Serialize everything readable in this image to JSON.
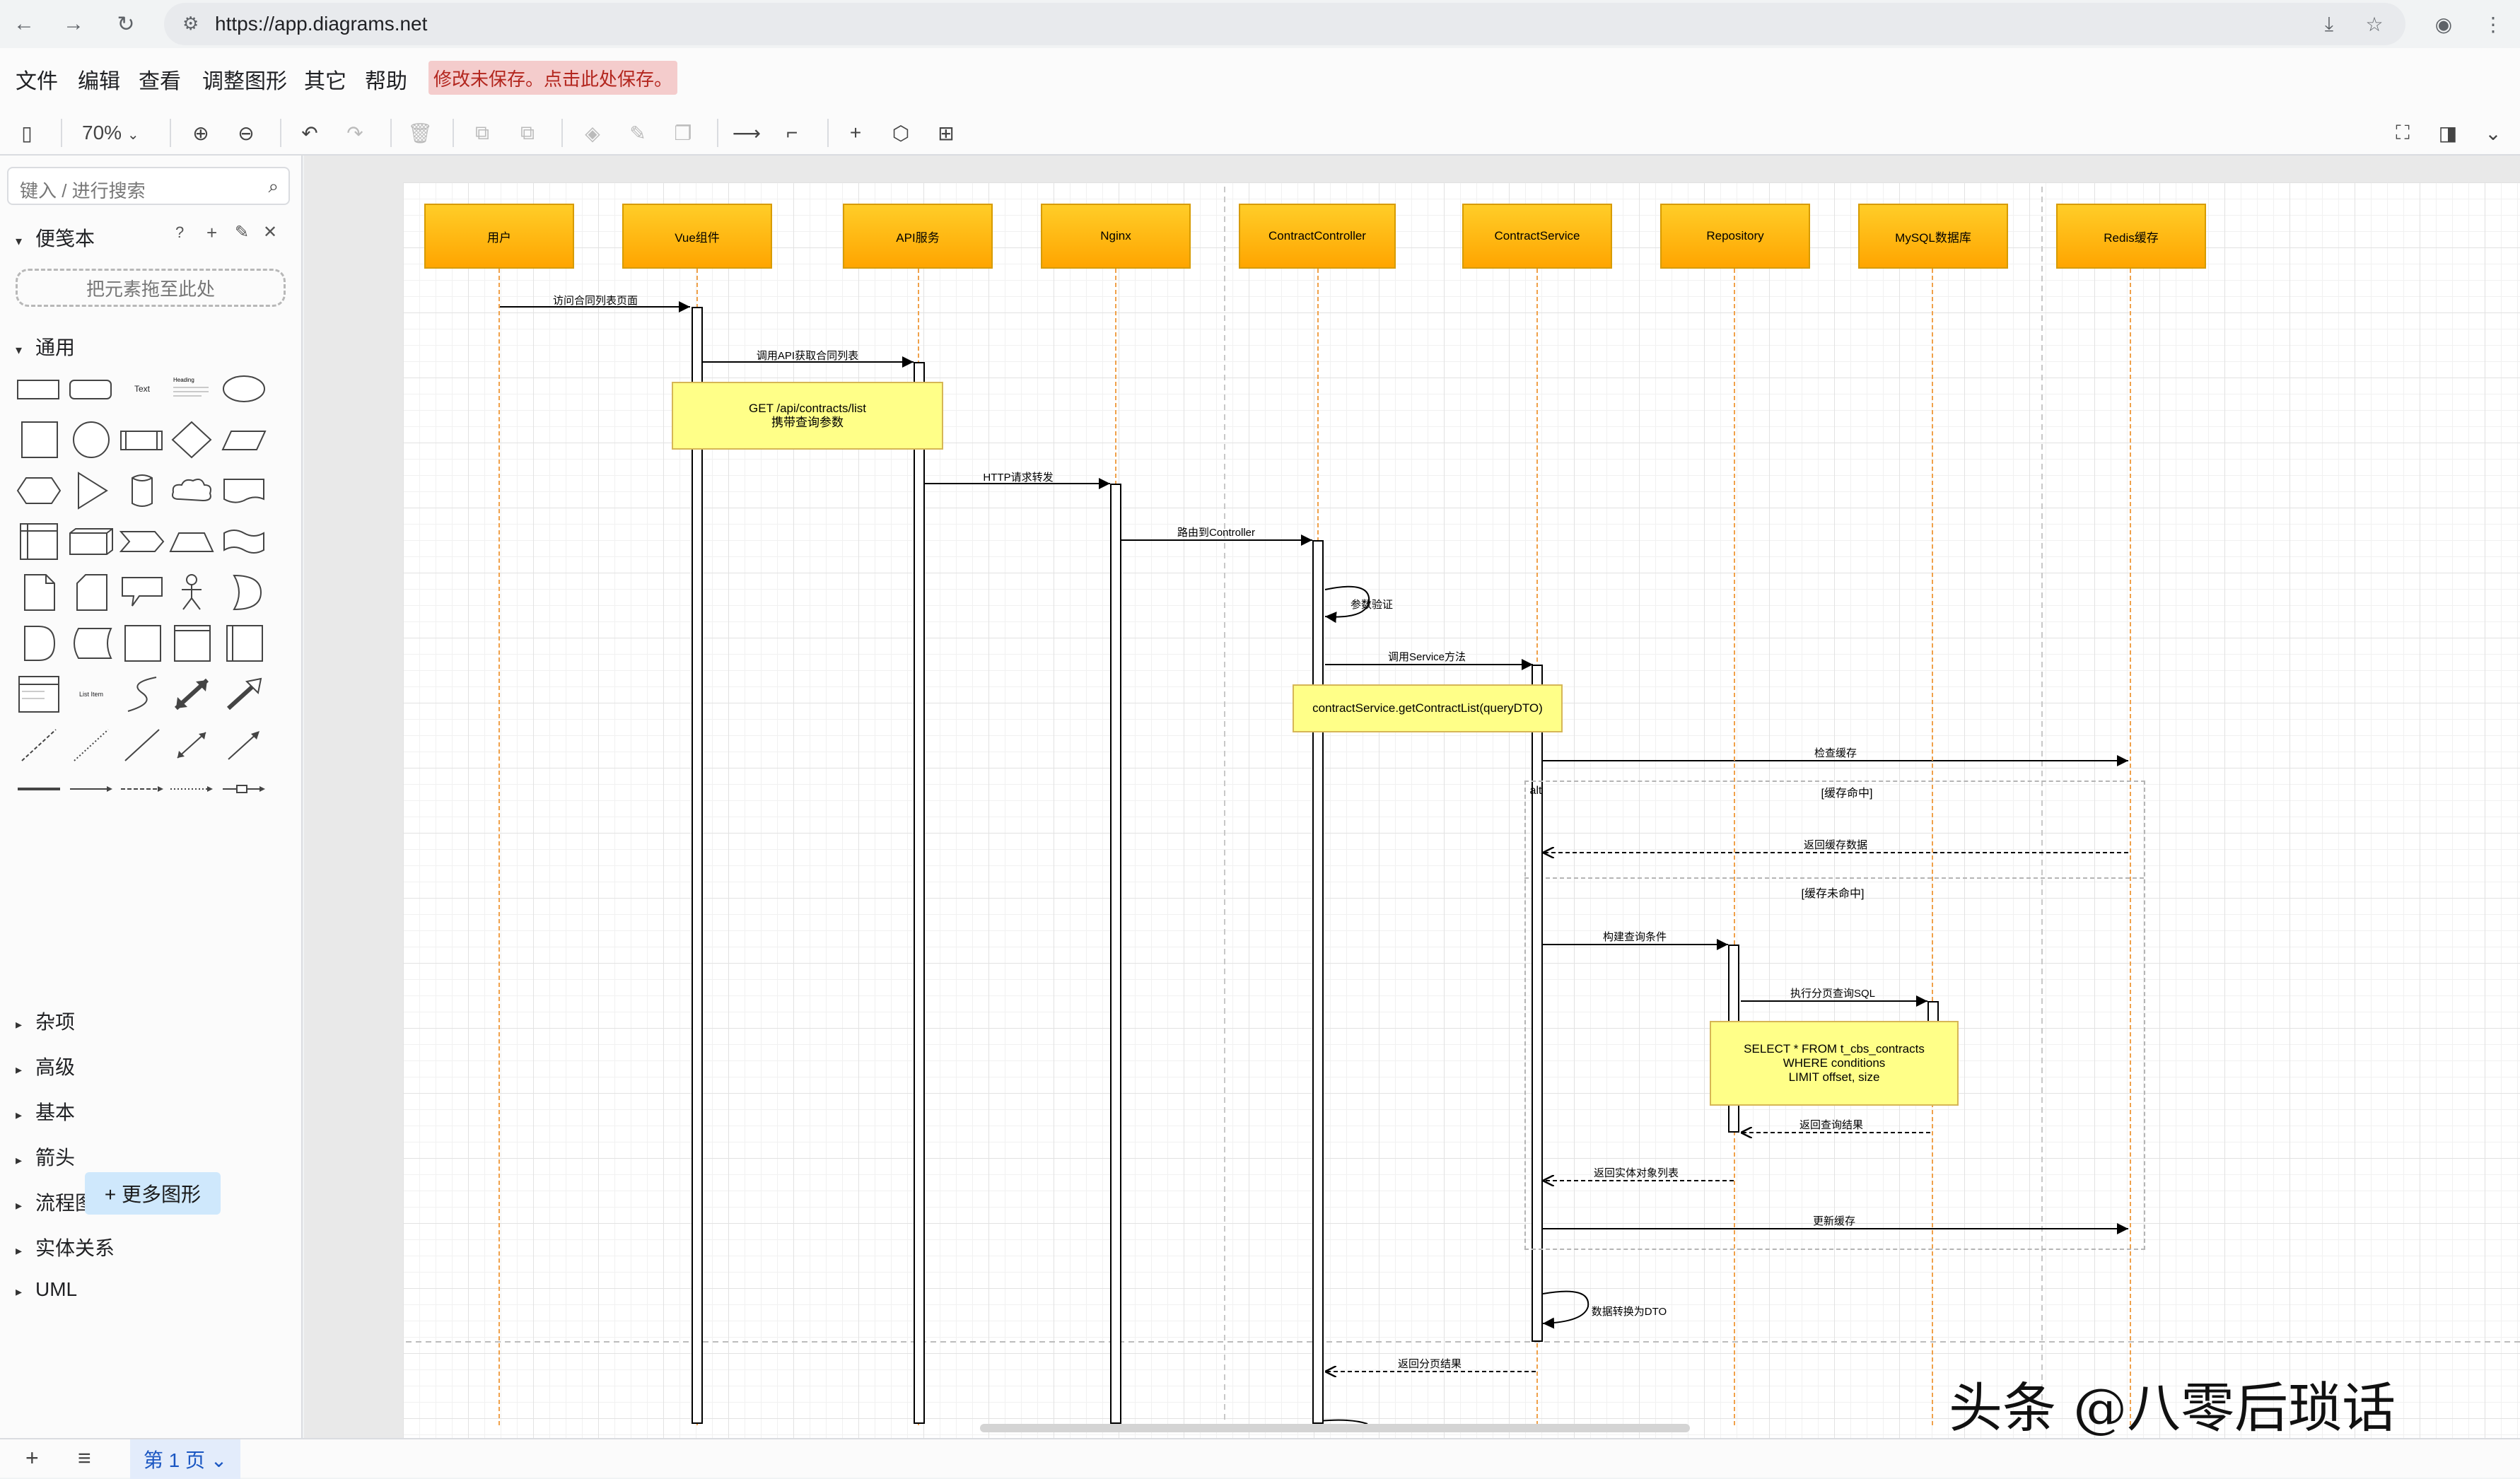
{
  "browser": {
    "url": "https://app.diagrams.net",
    "back_icon": "←",
    "forward_icon": "→",
    "reload_icon": "↻",
    "install_icon": "⤓",
    "star_icon": "☆",
    "profile_icon": "◉",
    "menu_icon": "⋮"
  },
  "menubar": {
    "items": [
      "文件",
      "编辑",
      "查看",
      "调整图形",
      "其它",
      "帮助"
    ],
    "unsaved_notice": "修改未保存。点击此处保存。"
  },
  "toolbar": {
    "zoom": "70%",
    "icons": {
      "sidebar": "▯",
      "zoom_in": "⊕",
      "zoom_out": "⊖",
      "undo": "↶",
      "redo": "↷",
      "delete": "🗑",
      "to_front": "⧉",
      "to_back": "⧉",
      "fill": "◈",
      "line": "✎",
      "shadow": "❐",
      "connection": "⟶",
      "waypoint": "⌐",
      "insert": "+",
      "shapes": "⬡",
      "table": "⊞",
      "fullscreen": "⛶",
      "format_panel": "◨",
      "collapse": "⌄"
    }
  },
  "sidebar": {
    "search_placeholder": "键入 / 进行搜索",
    "scratchpad": "便笺本",
    "scratchpad_drop": "把元素拖至此处",
    "general": "通用",
    "text_shape_label": "Text",
    "heading_shape_label": "Heading",
    "listitem_shape_label": "List Item",
    "categories": [
      "杂项",
      "高级",
      "基本",
      "箭头",
      "流程图",
      "实体关系",
      "UML"
    ],
    "more_shapes": "+ 更多图形",
    "icons": {
      "help": "?",
      "add": "+",
      "edit": "✎",
      "close": "✕",
      "expand": "▸",
      "collapse": "▾"
    }
  },
  "diagram": {
    "actors": [
      "用户",
      "Vue组件",
      "API服务",
      "Nginx",
      "ContractController",
      "ContractService",
      "Repository",
      "MySQL数据库",
      "Redis缓存"
    ],
    "messages": [
      "访问合同列表页面",
      "调用API获取合同列表",
      "HTTP请求转发",
      "路由到Controller",
      "参数验证",
      "调用Service方法",
      "检查缓存",
      "返回缓存数据",
      "构建查询条件",
      "执行分页查询SQL",
      "返回查询结果",
      "返回实体对象列表",
      "更新缓存",
      "数据转换为DTO",
      "返回分页结果"
    ],
    "notes": {
      "api": [
        "GET /api/contracts/list",
        "携带查询参数"
      ],
      "service": [
        "contractService.getContractList(queryDTO)"
      ],
      "sql": [
        "SELECT * FROM t_cbs_contracts",
        "WHERE conditions",
        "LIMIT offset, size"
      ]
    },
    "fragment": {
      "operator": "alt",
      "guard_hit": "[缓存命中]",
      "guard_miss": "[缓存未命中]"
    }
  },
  "watermark": "头条 @八零后琐话",
  "bottombar": {
    "add_page_icon": "+",
    "pages_menu_icon": "≡",
    "page_tab": "第 1 页 ⌄"
  }
}
